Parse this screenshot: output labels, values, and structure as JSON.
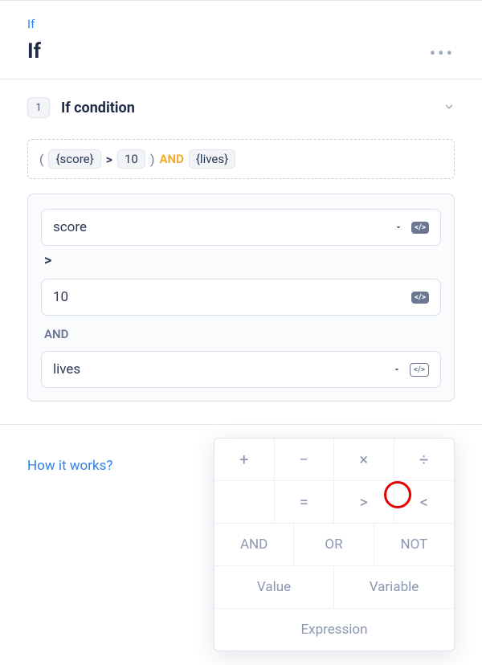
{
  "header": {
    "breadcrumb": "If",
    "title": "If"
  },
  "condition_section": {
    "step_number": "1",
    "title": "If condition",
    "expression": {
      "lparen": "(",
      "chip1": "{score}",
      "op1": ">",
      "chip2": "10",
      "rparen": ")",
      "logical": "AND",
      "chip3": "{lives}"
    },
    "builder": {
      "field1": "score",
      "op1": ">",
      "field2": "10",
      "logical_label": "AND",
      "field3": "lives"
    }
  },
  "footer": {
    "how_it_works": "How it works?"
  },
  "popover": {
    "row1": {
      "c1": "+",
      "c2": "−",
      "c3": "×",
      "c4": "÷"
    },
    "row2": {
      "c1": "=",
      "c2": ">",
      "c3": "<"
    },
    "row3": {
      "c1": "AND",
      "c2": "OR",
      "c3": "NOT"
    },
    "row4": {
      "c1": "Value",
      "c2": "Variable"
    },
    "row5": {
      "c1": "Expression"
    }
  }
}
